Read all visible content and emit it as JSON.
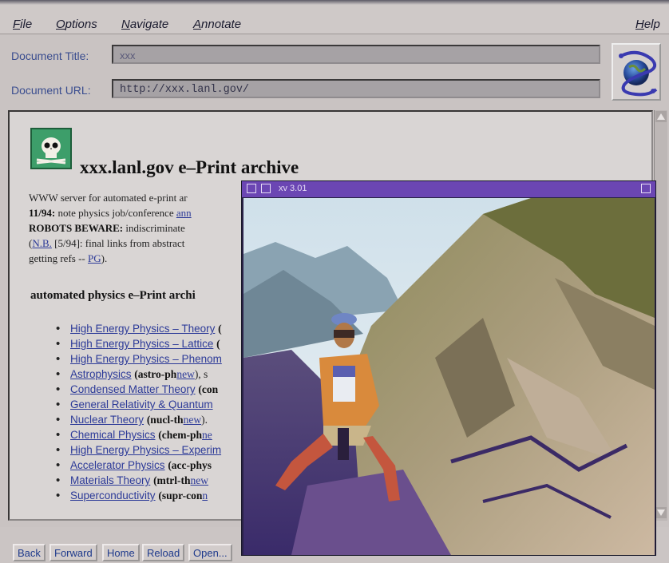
{
  "menu": {
    "file": "File",
    "options": "Options",
    "navigate": "Navigate",
    "annotate": "Annotate",
    "help": "Help"
  },
  "fields": {
    "title_label": "Document Title:",
    "title_value": "xxx",
    "url_label": "Document URL:",
    "url_value": "http://xxx.lanl.gov/"
  },
  "page": {
    "heading": "xxx.lanl.gov e–Print archive",
    "intro": "WWW server for automated e-print ar",
    "news_date": "11/94:",
    "news_text": "note physics job/conference",
    "news_link": "ann",
    "robots_label": "ROBOTS BEWARE:",
    "robots_text": "indiscriminate",
    "nb_link": "N.B.",
    "nb_text": "[5/94]: final links from abstract",
    "refs_text": "getting refs --",
    "refs_link": "PG",
    "refs_end": ").",
    "section_heading": "automated physics e–Print archi"
  },
  "archives": [
    {
      "name": "High Energy Physics – Theory",
      "code": "(",
      "extra": "",
      "plain": ""
    },
    {
      "name": "High Energy Physics – Lattice",
      "code": "(",
      "extra": "",
      "plain": ""
    },
    {
      "name": "High Energy Physics – Phenom",
      "code": "",
      "extra": "",
      "plain": ""
    },
    {
      "name": "Astrophysics",
      "code": "(astro-ph",
      "extra": "new",
      "plain": "), s"
    },
    {
      "name": "Condensed Matter Theory",
      "code": "(con",
      "extra": "",
      "plain": ""
    },
    {
      "name": "General Relativity & Quantum",
      "code": "",
      "extra": "",
      "plain": ""
    },
    {
      "name": "Nuclear Theory",
      "code": "(nucl-th",
      "extra": "new",
      "plain": ")."
    },
    {
      "name": "Chemical Physics",
      "code": "(chem-ph",
      "extra": "ne",
      "plain": ""
    },
    {
      "name": "High Energy Physics – Experim",
      "code": "",
      "extra": "",
      "plain": ""
    },
    {
      "name": "Accelerator Physics",
      "code": "(acc-phys",
      "extra": "",
      "plain": ""
    },
    {
      "name": "Materials Theory",
      "code": "(mtrl-th",
      "extra": "new",
      "plain": ""
    },
    {
      "name": "Superconductivity",
      "code": "(supr-con",
      "extra": "n",
      "plain": ""
    }
  ],
  "buttons": {
    "back": "Back",
    "forward": "Forward",
    "home": "Home",
    "reload": "Reload",
    "open": "Open..."
  },
  "xv": {
    "title": "xv 3.01"
  },
  "colors": {
    "link": "#2c3a98",
    "label": "#3a4d8f",
    "xv_titlebar": "#6b46b3"
  }
}
